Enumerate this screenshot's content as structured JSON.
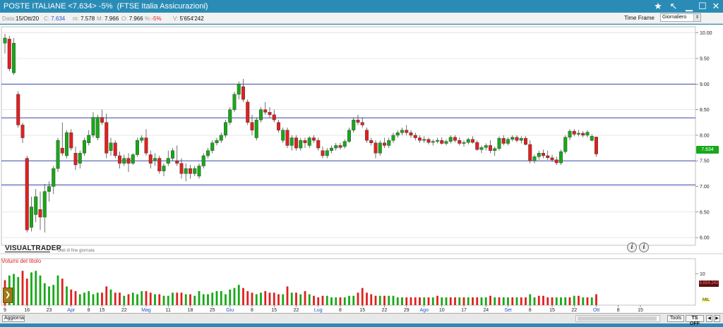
{
  "titlebar": {
    "title": "POSTE ITALIANE <7.634> -5%  (FTSE Italia Assicurazioni)",
    "star_icon": "star-icon",
    "collapse_icon": "collapse-arrow-icon",
    "minimize_icon": "minimize-icon",
    "maximize_icon": "maximize-icon",
    "close_icon": "close-icon"
  },
  "infobar": {
    "data_label": "Data:",
    "data_value": "15/Ott/20",
    "c_label": "C:",
    "c_value": "7.634",
    "m_label": "m:",
    "m_value": "7.578",
    "M_label": "M:",
    "M_value": "7.966",
    "o_label": "O:",
    "o_value": "7.966",
    "pct_label": "%:",
    "pct_value": "-5%",
    "v_label": "V:",
    "v_value": "5'654'242",
    "timeframe_label": "Time Frame",
    "timeframe_value": "Giornaliero"
  },
  "chart_labels": {
    "logo": "VISUALTRADER",
    "eod": "Dati di fine giornata",
    "volume_title": "Volumi del titolo",
    "price_tag": "7.634",
    "volume_tag": "5,654,242",
    "mil_tag": "MIL"
  },
  "colors": {
    "up": "#18a818",
    "down": "#e02020",
    "hline": "#1c2c9c",
    "grid": "#d8d8d8",
    "axis_text": "#222222",
    "month_text": "#2050c8"
  },
  "chart_data": [
    {
      "type": "candlestick",
      "title": "POSTE ITALIANE",
      "y_ticks": [
        "10.00",
        "9.50",
        "9.00",
        "8.50",
        "8.00",
        "7.50",
        "7.00",
        "6.50",
        "6.00"
      ],
      "ylim": [
        5.85,
        10.12
      ],
      "horizontal_lines": [
        9.0,
        8.34,
        7.5,
        7.03
      ],
      "last_price": 7.634,
      "x_labels": [
        "9",
        "16",
        "23",
        "Apr",
        "8",
        "15",
        "22",
        "Mag",
        "11",
        "18",
        "25",
        "Giu",
        "8",
        "15",
        "22",
        "Lug",
        "8",
        "15",
        "22",
        "29",
        "Ago",
        "10",
        "17",
        "24",
        "Set",
        "8",
        "15",
        "22",
        "Ott",
        "8",
        "15"
      ],
      "x_label_index": [
        0,
        5,
        10,
        15,
        19,
        22,
        27,
        32,
        37,
        42,
        47,
        51,
        56,
        61,
        66,
        71,
        76,
        81,
        86,
        91,
        95,
        99,
        104,
        109,
        114,
        119,
        124,
        129,
        134,
        139,
        144
      ],
      "x_label_month": [
        false,
        false,
        false,
        true,
        false,
        false,
        false,
        true,
        false,
        false,
        false,
        true,
        false,
        false,
        false,
        true,
        false,
        false,
        false,
        false,
        true,
        false,
        false,
        false,
        true,
        false,
        false,
        false,
        true,
        false,
        false
      ],
      "ohlc": [
        [
          9.8,
          9.98,
          9.6,
          9.9
        ],
        [
          9.88,
          9.94,
          9.25,
          9.3
        ],
        [
          9.22,
          9.9,
          9.18,
          9.8
        ],
        [
          8.8,
          8.86,
          8.15,
          8.2
        ],
        [
          8.2,
          8.25,
          7.85,
          7.95
        ],
        [
          7.55,
          7.6,
          6.1,
          6.15
        ],
        [
          6.2,
          6.8,
          6.12,
          6.6
        ],
        [
          6.45,
          6.95,
          6.3,
          6.8
        ],
        [
          6.55,
          6.9,
          6.15,
          6.4
        ],
        [
          6.4,
          7.05,
          6.1,
          6.9
        ],
        [
          6.9,
          7.1,
          6.7,
          7.0
        ],
        [
          7.0,
          7.4,
          6.85,
          7.35
        ],
        [
          7.35,
          7.95,
          7.28,
          7.9
        ],
        [
          7.75,
          8.25,
          7.6,
          7.65
        ],
        [
          7.6,
          8.1,
          7.55,
          8.05
        ],
        [
          8.05,
          8.12,
          7.7,
          7.75
        ],
        [
          7.65,
          7.78,
          7.32,
          7.42
        ],
        [
          7.45,
          7.7,
          7.35,
          7.65
        ],
        [
          7.65,
          7.95,
          7.6,
          7.9
        ],
        [
          7.85,
          8.1,
          7.8,
          8.0
        ],
        [
          8.0,
          8.45,
          7.95,
          8.35
        ],
        [
          7.95,
          8.4,
          7.9,
          8.35
        ],
        [
          8.35,
          8.5,
          8.2,
          8.25
        ],
        [
          8.25,
          8.42,
          7.55,
          7.65
        ],
        [
          7.7,
          7.95,
          7.6,
          7.85
        ],
        [
          7.85,
          7.9,
          7.55,
          7.6
        ],
        [
          7.6,
          7.68,
          7.35,
          7.45
        ],
        [
          7.45,
          7.62,
          7.4,
          7.55
        ],
        [
          7.55,
          7.65,
          7.28,
          7.45
        ],
        [
          7.45,
          7.65,
          7.42,
          7.62
        ],
        [
          7.62,
          7.95,
          7.58,
          7.9
        ],
        [
          7.9,
          8.0,
          7.85,
          7.95
        ],
        [
          7.95,
          8.12,
          7.6,
          7.65
        ],
        [
          7.62,
          7.7,
          7.35,
          7.45
        ],
        [
          7.5,
          7.65,
          7.4,
          7.55
        ],
        [
          7.55,
          7.6,
          7.25,
          7.3
        ],
        [
          7.3,
          7.45,
          7.2,
          7.4
        ],
        [
          7.45,
          7.7,
          7.4,
          7.55
        ],
        [
          7.55,
          7.75,
          7.5,
          7.7
        ],
        [
          7.5,
          7.8,
          7.4,
          7.45
        ],
        [
          7.45,
          7.55,
          7.15,
          7.25
        ],
        [
          7.25,
          7.45,
          7.1,
          7.35
        ],
        [
          7.35,
          7.42,
          7.15,
          7.25
        ],
        [
          7.25,
          7.4,
          7.2,
          7.35
        ],
        [
          7.2,
          7.45,
          7.15,
          7.4
        ],
        [
          7.4,
          7.65,
          7.35,
          7.6
        ],
        [
          7.6,
          7.75,
          7.55,
          7.7
        ],
        [
          7.7,
          7.9,
          7.65,
          7.85
        ],
        [
          7.85,
          7.95,
          7.8,
          7.9
        ],
        [
          7.9,
          8.05,
          7.85,
          8.0
        ],
        [
          8.0,
          8.3,
          7.95,
          8.25
        ],
        [
          8.25,
          8.55,
          8.2,
          8.5
        ],
        [
          8.5,
          8.85,
          8.45,
          8.8
        ],
        [
          8.8,
          9.05,
          8.7,
          9.0
        ],
        [
          8.95,
          9.1,
          8.65,
          8.7
        ],
        [
          8.65,
          8.7,
          8.2,
          8.25
        ],
        [
          8.25,
          8.4,
          8.0,
          8.1
        ],
        [
          7.95,
          8.35,
          7.9,
          8.3
        ],
        [
          8.3,
          8.55,
          8.25,
          8.5
        ],
        [
          8.5,
          8.65,
          8.4,
          8.45
        ],
        [
          8.45,
          8.55,
          8.35,
          8.4
        ],
        [
          8.4,
          8.5,
          8.25,
          8.3
        ],
        [
          8.25,
          8.3,
          8.05,
          8.1
        ],
        [
          7.9,
          8.15,
          7.85,
          8.1
        ],
        [
          8.1,
          8.15,
          7.75,
          7.8
        ],
        [
          7.8,
          8.0,
          7.7,
          7.95
        ],
        [
          7.95,
          8.0,
          7.7,
          7.75
        ],
        [
          7.75,
          7.95,
          7.7,
          7.9
        ],
        [
          7.9,
          7.95,
          7.75,
          7.85
        ],
        [
          7.8,
          7.98,
          7.75,
          7.95
        ],
        [
          7.95,
          8.0,
          7.85,
          7.9
        ],
        [
          7.9,
          7.95,
          7.7,
          7.75
        ],
        [
          7.7,
          7.78,
          7.55,
          7.6
        ],
        [
          7.6,
          7.75,
          7.55,
          7.7
        ],
        [
          7.7,
          7.8,
          7.65,
          7.75
        ],
        [
          7.75,
          7.85,
          7.7,
          7.8
        ],
        [
          7.8,
          7.85,
          7.72,
          7.76
        ],
        [
          7.78,
          7.92,
          7.74,
          7.88
        ],
        [
          7.88,
          8.15,
          7.85,
          8.1
        ],
        [
          8.1,
          8.35,
          8.05,
          8.3
        ],
        [
          8.3,
          8.4,
          8.2,
          8.25
        ],
        [
          8.25,
          8.35,
          8.15,
          8.2
        ],
        [
          8.1,
          8.15,
          7.85,
          7.9
        ],
        [
          7.9,
          7.95,
          7.8,
          7.85
        ],
        [
          7.85,
          7.9,
          7.55,
          7.65
        ],
        [
          7.65,
          7.9,
          7.6,
          7.85
        ],
        [
          7.85,
          7.95,
          7.75,
          7.8
        ],
        [
          7.8,
          7.95,
          7.75,
          7.9
        ],
        [
          7.9,
          8.05,
          7.85,
          8.0
        ],
        [
          8.0,
          8.1,
          7.95,
          8.05
        ],
        [
          8.05,
          8.15,
          8.0,
          8.1
        ],
        [
          8.1,
          8.2,
          8.0,
          8.05
        ],
        [
          8.05,
          8.1,
          7.95,
          8.0
        ],
        [
          8.0,
          8.05,
          7.9,
          7.95
        ],
        [
          7.95,
          8.0,
          7.85,
          7.9
        ],
        [
          7.9,
          7.98,
          7.85,
          7.92
        ],
        [
          7.92,
          7.95,
          7.82,
          7.86
        ],
        [
          7.86,
          7.92,
          7.8,
          7.88
        ],
        [
          7.88,
          7.95,
          7.84,
          7.9
        ],
        [
          7.9,
          7.96,
          7.82,
          7.84
        ],
        [
          7.84,
          7.92,
          7.8,
          7.88
        ],
        [
          7.88,
          8.0,
          7.84,
          7.96
        ],
        [
          7.96,
          8.0,
          7.86,
          7.9
        ],
        [
          7.9,
          7.96,
          7.8,
          7.84
        ],
        [
          7.84,
          7.9,
          7.78,
          7.86
        ],
        [
          7.86,
          7.95,
          7.82,
          7.92
        ],
        [
          7.92,
          7.98,
          7.84,
          7.86
        ],
        [
          7.86,
          7.9,
          7.7,
          7.72
        ],
        [
          7.72,
          7.8,
          7.65,
          7.76
        ],
        [
          7.76,
          7.84,
          7.7,
          7.8
        ],
        [
          7.8,
          7.9,
          7.65,
          7.7
        ],
        [
          7.7,
          7.78,
          7.6,
          7.74
        ],
        [
          7.74,
          7.98,
          7.7,
          7.94
        ],
        [
          7.94,
          8.0,
          7.8,
          7.84
        ],
        [
          7.84,
          7.96,
          7.8,
          7.92
        ],
        [
          7.92,
          8.0,
          7.88,
          7.96
        ],
        [
          7.96,
          8.0,
          7.86,
          7.9
        ],
        [
          7.9,
          7.98,
          7.84,
          7.94
        ],
        [
          7.94,
          7.98,
          7.8,
          7.82
        ],
        [
          7.82,
          7.9,
          7.45,
          7.5
        ],
        [
          7.5,
          7.62,
          7.45,
          7.58
        ],
        [
          7.58,
          7.7,
          7.52,
          7.65
        ],
        [
          7.65,
          7.72,
          7.55,
          7.6
        ],
        [
          7.6,
          7.7,
          7.52,
          7.56
        ],
        [
          7.56,
          7.62,
          7.48,
          7.52
        ],
        [
          7.52,
          7.58,
          7.42,
          7.46
        ],
        [
          7.46,
          7.72,
          7.42,
          7.68
        ],
        [
          7.68,
          8.0,
          7.64,
          7.96
        ],
        [
          7.96,
          8.12,
          7.9,
          8.08
        ],
        [
          8.08,
          8.12,
          7.98,
          8.02
        ],
        [
          8.02,
          8.1,
          7.98,
          8.04
        ],
        [
          8.04,
          8.08,
          7.96,
          8.0
        ],
        [
          8.0,
          8.1,
          7.96,
          8.06
        ],
        [
          7.9,
          8.02,
          7.88,
          7.98
        ],
        [
          7.966,
          7.966,
          7.578,
          7.634
        ]
      ]
    },
    {
      "type": "bar",
      "title": "Volumi del titolo",
      "y_ticks": [
        "10"
      ],
      "volumes": [
        8,
        9.5,
        10,
        9,
        11,
        8.5,
        10.5,
        11,
        9.5,
        7,
        6,
        6.5,
        9.5,
        8.5,
        6,
        5,
        4.5,
        3.5,
        4,
        4.5,
        3.5,
        4,
        4,
        6,
        5,
        4,
        4,
        3,
        3.5,
        4,
        3.5,
        4.5,
        4.5,
        4,
        3.5,
        3.5,
        3,
        3,
        4,
        4,
        4,
        3.5,
        3.5,
        3,
        4.5,
        3.5,
        3.5,
        4,
        4.5,
        4.5,
        3.5,
        5,
        5.5,
        6.5,
        5.5,
        4.5,
        4,
        3.5,
        4,
        4.5,
        4,
        4,
        3.5,
        3.5,
        6,
        4,
        4,
        3.5,
        4.5,
        3.5,
        3,
        2.5,
        3,
        3,
        2.5,
        2.5,
        2.5,
        2.5,
        3,
        3,
        4,
        5.5,
        4,
        3.5,
        3,
        3,
        3,
        3,
        3,
        2.5,
        2.5,
        2.5,
        2.5,
        2.5,
        2.5,
        2.5,
        2.5,
        2.5,
        3,
        2.5,
        2.5,
        2.5,
        2.5,
        2.5,
        2.5,
        2.5,
        2.5,
        2.5,
        2.5,
        2.5,
        3,
        2.5,
        2.5,
        2.5,
        2.5,
        2.5,
        2.5,
        2.5,
        2.5,
        3.5,
        2.5,
        3,
        3,
        2.5,
        2.5,
        2.5,
        2.5,
        2.5,
        2.5,
        3,
        3,
        2.5,
        2.5,
        2.5,
        3.5
      ],
      "volume_up": [
        0,
        1,
        1,
        1,
        0,
        0,
        1,
        1,
        1,
        1,
        1,
        1,
        1,
        0,
        1,
        0,
        0,
        1,
        1,
        1,
        1,
        1,
        0,
        0,
        1,
        0,
        0,
        1,
        0,
        1,
        1,
        1,
        0,
        0,
        1,
        0,
        1,
        1,
        1,
        0,
        0,
        1,
        0,
        1,
        1,
        1,
        1,
        1,
        1,
        1,
        1,
        1,
        1,
        1,
        0,
        0,
        0,
        1,
        1,
        0,
        0,
        0,
        0,
        1,
        0,
        1,
        0,
        1,
        0,
        1,
        0,
        0,
        0,
        1,
        1,
        1,
        0,
        1,
        1,
        1,
        0,
        0,
        0,
        0,
        0,
        1,
        0,
        1,
        1,
        1,
        1,
        0,
        0,
        0,
        0,
        1,
        0,
        1,
        0,
        1,
        1,
        0,
        0,
        1,
        0,
        1,
        0,
        0,
        1,
        1,
        0,
        1,
        0,
        1,
        1,
        0,
        1,
        0,
        0,
        1,
        1,
        0,
        0,
        0,
        0,
        1,
        1,
        1,
        0,
        1,
        0,
        1,
        0,
        1,
        0
      ]
    }
  ],
  "statusbar": {
    "update_button": "Aggiorna",
    "tools_button": "Tools",
    "ts_button": "TS OFF"
  }
}
